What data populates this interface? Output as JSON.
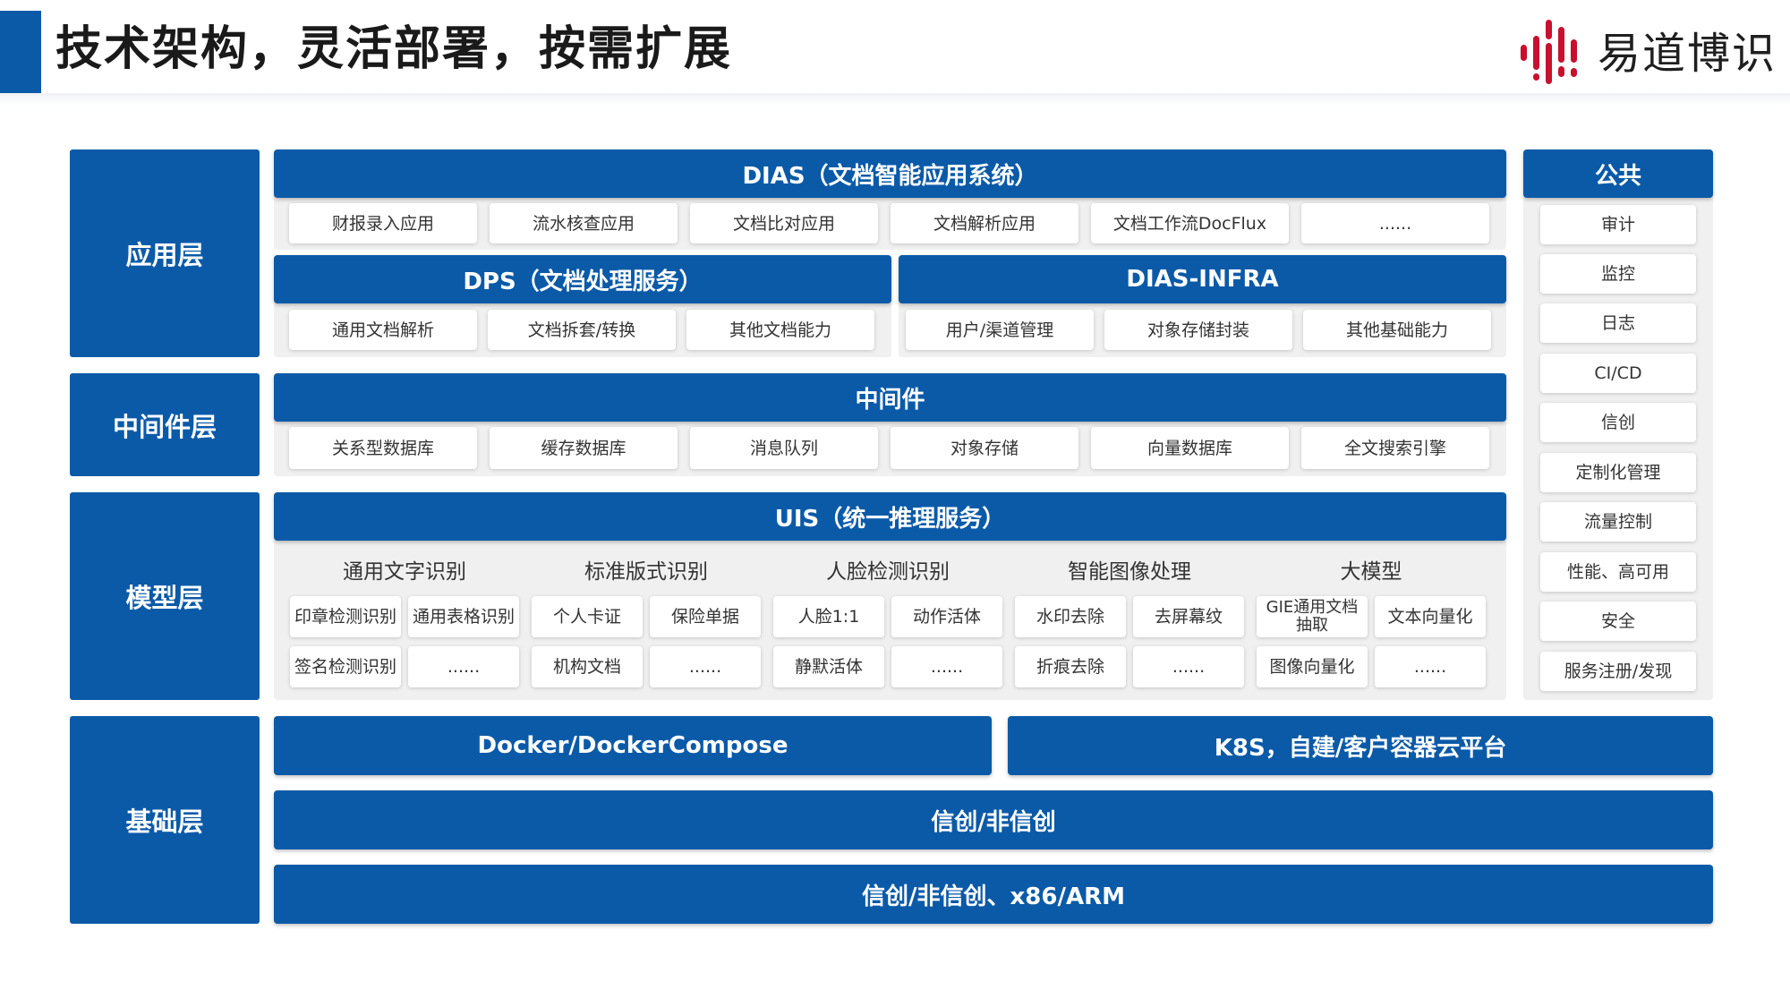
{
  "title": "技术架构，灵活部署，按需扩展",
  "brand": {
    "name": "易道博识",
    "icon": "bars-logo-icon",
    "color": "#c8102e"
  },
  "colors": {
    "primary": "#0b5aa8",
    "panel": "#f0f0f0"
  },
  "layers": {
    "app": "应用层",
    "middleware": "中间件层",
    "model": "模型层",
    "base": "基础层"
  },
  "app": {
    "dias_title": "DIAS（文档智能应用系统）",
    "dias_items": [
      "财报录入应用",
      "流水核查应用",
      "文档比对应用",
      "文档解析应用",
      "文档工作流DocFlux",
      "......"
    ],
    "dps_title": "DPS（文档处理服务）",
    "dps_items": [
      "通用文档解析",
      "文档拆套/转换",
      "其他文档能力"
    ],
    "infra_title": "DIAS-INFRA",
    "infra_items": [
      "用户/渠道管理",
      "对象存储封装",
      "其他基础能力"
    ]
  },
  "middleware": {
    "title": "中间件",
    "items": [
      "关系型数据库",
      "缓存数据库",
      "消息队列",
      "对象存储",
      "向量数据库",
      "全文搜索引擎"
    ]
  },
  "model": {
    "title": "UIS（统一推理服务）",
    "groups": [
      {
        "name": "通用文字识别",
        "items": [
          "印章检测识别",
          "通用表格识别",
          "签名检测识别",
          "......"
        ]
      },
      {
        "name": "标准版式识别",
        "items": [
          "个人卡证",
          "保险单据",
          "机构文档",
          "......"
        ]
      },
      {
        "name": "人脸检测识别",
        "items": [
          "人脸1:1",
          "动作活体",
          "静默活体",
          "......"
        ]
      },
      {
        "name": "智能图像处理",
        "items": [
          "水印去除",
          "去屏幕纹",
          "折痕去除",
          "......"
        ]
      },
      {
        "name": "大模型",
        "items": [
          "GIE通用文档抽取",
          "文本向量化",
          "图像向量化",
          "......"
        ]
      }
    ]
  },
  "public": {
    "title": "公共",
    "items": [
      "审计",
      "监控",
      "日志",
      "CI/CD",
      "信创",
      "定制化管理",
      "流量控制",
      "性能、高可用",
      "安全",
      "服务注册/发现"
    ]
  },
  "base": {
    "docker": "Docker/DockerCompose",
    "k8s": "K8S，自建/客户容器云平台",
    "xinchuang": "信创/非信创",
    "arch": "信创/非信创、x86/ARM"
  }
}
